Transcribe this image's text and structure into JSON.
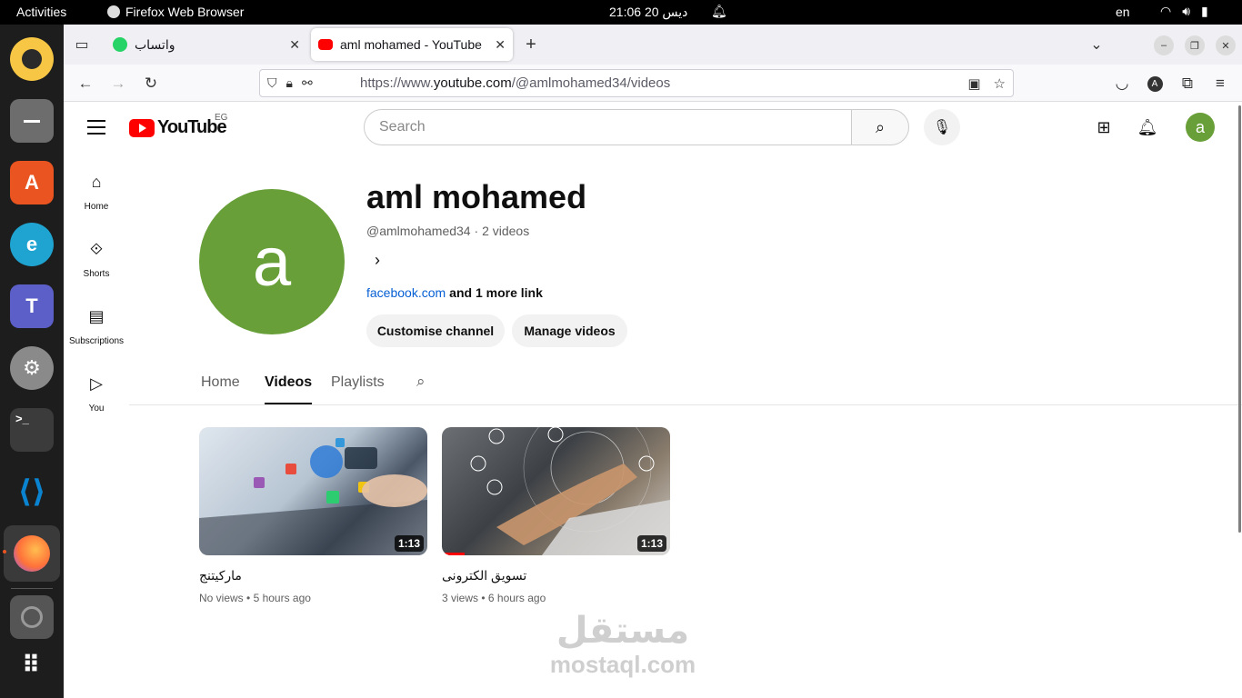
{
  "system": {
    "activities": "Activities",
    "app_name": "Firefox Web Browser",
    "clock": "21:06  ديس 20",
    "lang": "en"
  },
  "dock": [
    {
      "name": "rhythmbox-icon",
      "color": "#f6c644"
    },
    {
      "name": "files-icon",
      "color": "#6d6d6d"
    },
    {
      "name": "app-center-icon",
      "color": "#e95420"
    },
    {
      "name": "edge-icon",
      "color": "#1fa3d1"
    },
    {
      "name": "teams-icon",
      "color": "#5b5fc7"
    },
    {
      "name": "settings-icon",
      "color": "#8a8a8a"
    },
    {
      "name": "terminal-icon",
      "color": "#3b3b3b"
    },
    {
      "name": "vscode-icon",
      "color": "#0a84d0"
    },
    {
      "name": "firefox-icon",
      "color": "#ff7139"
    },
    {
      "name": "disc-icon",
      "color": "#555555"
    },
    {
      "name": "app-grid-icon",
      "color": "#ffffff"
    }
  ],
  "browser": {
    "tabs": [
      {
        "title": "واتساب",
        "favicon": "whatsapp-icon",
        "color": "#25d366"
      },
      {
        "title": "aml mohamed - YouTube",
        "favicon": "youtube-icon",
        "color": "#ff0000"
      }
    ],
    "url_prefix": "https://www.",
    "url_domain": "youtube.com",
    "url_path": "/@amlmohamed34/videos"
  },
  "yt": {
    "logo_text": "YouTube",
    "country_code": "EG",
    "search_placeholder": "Search",
    "avatar_letter": "a",
    "guide": [
      {
        "label": "Home",
        "icon": "home-icon"
      },
      {
        "label": "Shorts",
        "icon": "shorts-icon"
      },
      {
        "label": "Subscriptions",
        "icon": "subscriptions-icon"
      },
      {
        "label": "You",
        "icon": "you-icon"
      }
    ],
    "channel": {
      "name": "aml mohamed",
      "handle": "@amlmohamed34",
      "separator": " · ",
      "video_count": "2 videos",
      "link": "facebook.com",
      "more_links": "and 1 more link",
      "customise_label": "Customise channel",
      "manage_label": "Manage videos"
    },
    "tabs": [
      "Home",
      "Videos",
      "Playlists"
    ],
    "videos": [
      {
        "title": "ماركيتنج",
        "views": "No views",
        "age": "5 hours ago",
        "duration": "1:13",
        "watched": 0
      },
      {
        "title": "تسويق الكترونى",
        "views": "3 views",
        "age": "6 hours ago",
        "duration": "1:13",
        "watched": 0.1
      }
    ],
    "meta_dot": " • "
  },
  "watermark": {
    "arabic": "مستقل",
    "latin": "mostaql.com"
  }
}
